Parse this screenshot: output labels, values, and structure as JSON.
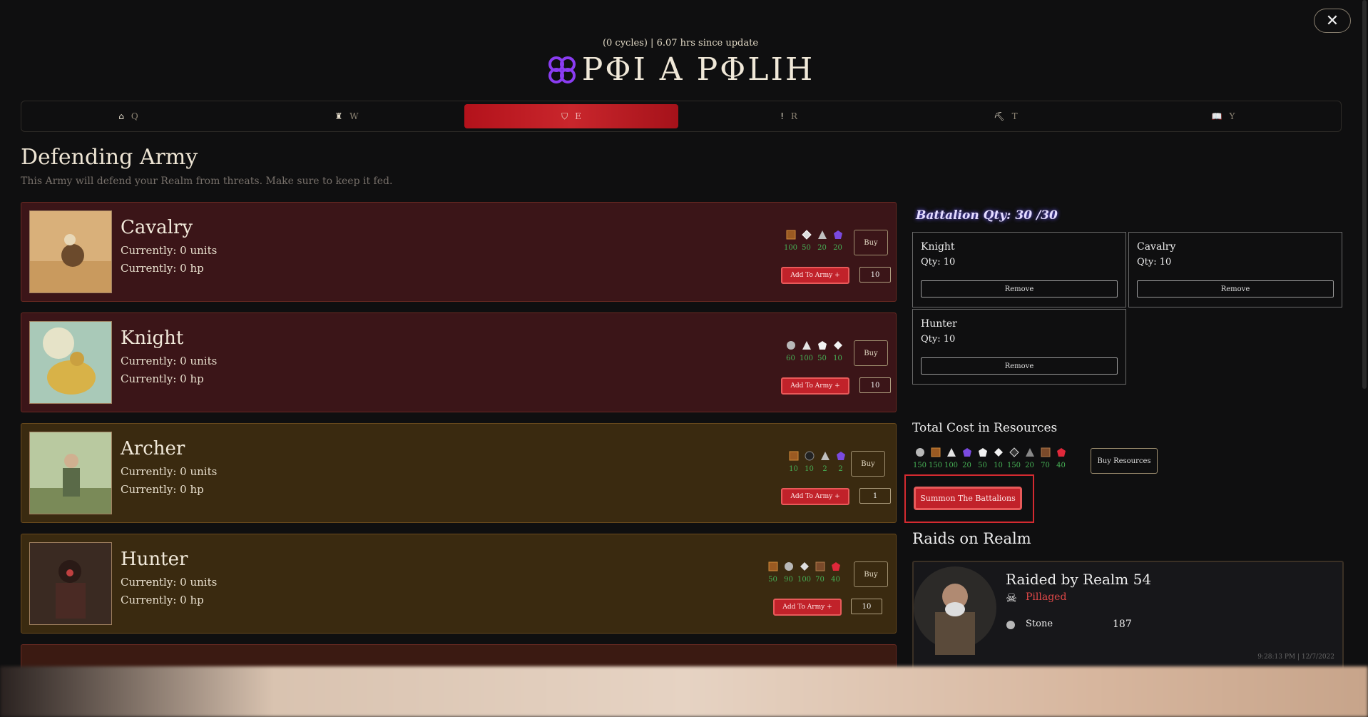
{
  "header": {
    "cycles_text": "(0 cycles) | 6.07 hrs since update",
    "brand_name": "PΦI A PΦLIH"
  },
  "tabs": [
    {
      "icon": "house-icon",
      "label": "Q"
    },
    {
      "icon": "castle-icon",
      "label": "W"
    },
    {
      "icon": "shield-icon",
      "label": "E"
    },
    {
      "icon": "exclamation-icon",
      "label": "R"
    },
    {
      "icon": "pickaxe-icon",
      "label": "T"
    },
    {
      "icon": "book-icon",
      "label": "Y"
    }
  ],
  "active_tab": "E",
  "page": {
    "title": "Defending Army",
    "subtitle": "This Army will defend your Realm from threats. Make sure to keep it fed."
  },
  "units": [
    {
      "name": "Cavalry",
      "units": "Currently: 0 units",
      "hp": "Currently: 0 hp",
      "buy": "Buy",
      "add": "Add To Army +",
      "qty": "10",
      "resources": [
        {
          "icon": "wood-icon",
          "v": "100"
        },
        {
          "icon": "diamond-icon",
          "v": "50"
        },
        {
          "icon": "triangle-icon",
          "v": "20"
        },
        {
          "icon": "purple-gem-icon",
          "v": "20"
        }
      ]
    },
    {
      "name": "Knight",
      "units": "Currently: 0 units",
      "hp": "Currently: 0 hp",
      "buy": "Buy",
      "add": "Add To Army +",
      "qty": "10",
      "resources": [
        {
          "icon": "stone-icon",
          "v": "60"
        },
        {
          "icon": "triangle-icon",
          "v": "100"
        },
        {
          "icon": "pentagon-icon",
          "v": "50"
        },
        {
          "icon": "diamond-icon",
          "v": "10"
        }
      ]
    },
    {
      "name": "Archer",
      "units": "Currently: 0 units",
      "hp": "Currently: 0 hp",
      "buy": "Buy",
      "add": "Add To Army +",
      "qty": "1",
      "resources": [
        {
          "icon": "wood-icon",
          "v": "10"
        },
        {
          "icon": "coal-icon",
          "v": "10"
        },
        {
          "icon": "triangle-icon",
          "v": "2"
        },
        {
          "icon": "purple-gem-icon",
          "v": "2"
        }
      ]
    },
    {
      "name": "Hunter",
      "units": "Currently: 0 units",
      "hp": "Currently: 0 hp",
      "buy": "Buy",
      "add": "Add To Army +",
      "qty": "10",
      "resources": [
        {
          "icon": "wood-icon",
          "v": "50"
        },
        {
          "icon": "stone-icon",
          "v": "90"
        },
        {
          "icon": "diamond-icon",
          "v": "100"
        },
        {
          "icon": "brown-block-icon",
          "v": "70"
        },
        {
          "icon": "ruby-icon",
          "v": "40"
        }
      ]
    }
  ],
  "battalion": {
    "title": "Battalion Qty: 30 /30",
    "items": [
      {
        "name": "Knight",
        "qty": "Qty: 10",
        "remove": "Remove"
      },
      {
        "name": "Cavalry",
        "qty": "Qty: 10",
        "remove": "Remove"
      },
      {
        "name": "Hunter",
        "qty": "Qty: 10",
        "remove": "Remove"
      }
    ]
  },
  "total_cost": {
    "title": "Total Cost in Resources",
    "resources": [
      {
        "icon": "stone-icon",
        "v": "150"
      },
      {
        "icon": "wood-icon",
        "v": "150"
      },
      {
        "icon": "triangle-icon",
        "v": "100"
      },
      {
        "icon": "purple-gem-icon",
        "v": "20"
      },
      {
        "icon": "pentagon-icon",
        "v": "50"
      },
      {
        "icon": "diamond-icon",
        "v": "10"
      },
      {
        "icon": "diamond-outline-icon",
        "v": "150"
      },
      {
        "icon": "grey-triangle-icon",
        "v": "20"
      },
      {
        "icon": "brown-block-icon",
        "v": "70"
      },
      {
        "icon": "ruby-icon",
        "v": "40"
      }
    ],
    "buy_resources": "Buy Resources",
    "summon": "Summon The Battalions"
  },
  "raids": {
    "title": "Raids on Realm",
    "card": {
      "title": "Raided by Realm 54",
      "status": "Pillaged",
      "resource": "Stone",
      "amount": "187",
      "time": "9:28:13 PM | 12/7/2022"
    }
  },
  "colors": {
    "accent_red": "#c1222a",
    "card_red": "#3b1518",
    "card_gold": "#3a2a10",
    "number_green": "#46b055"
  }
}
